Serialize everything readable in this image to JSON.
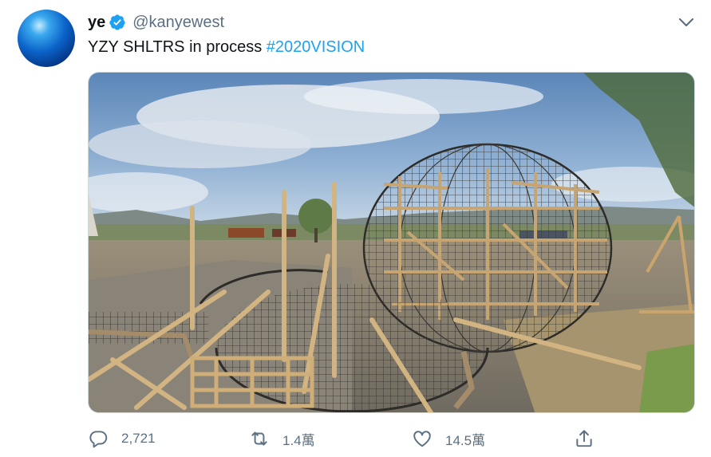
{
  "tweet": {
    "display_name": "ye",
    "handle": "@kanyewest",
    "text": "YZY SHLTRS in process ",
    "hashtag": "#2020VISION",
    "verified": true,
    "accent_color": "#1da1f2"
  },
  "actions": {
    "replies": "2,721",
    "retweets": "1.4萬",
    "likes": "14.5萬"
  },
  "icons": {
    "menu": "chevron-down-icon",
    "reply": "reply-icon",
    "retweet": "retweet-icon",
    "like": "heart-icon",
    "share": "share-icon"
  }
}
